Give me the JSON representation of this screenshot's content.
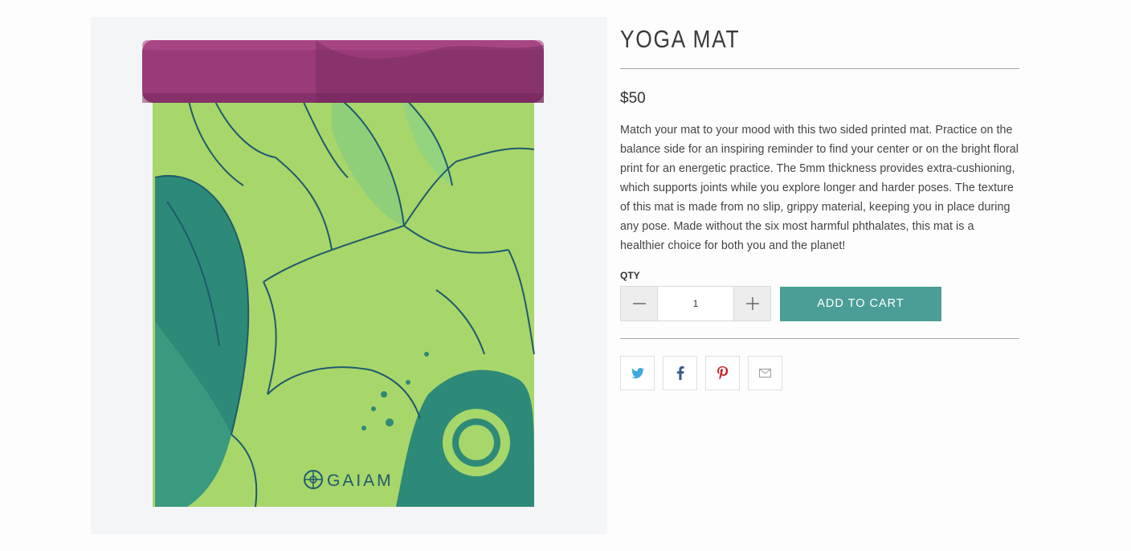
{
  "product": {
    "title": "YOGA MAT",
    "price": "$50",
    "description": "Match your mat to your mood with this two sided printed mat. Practice on the balance side for an inspiring reminder to find your center or on the bright floral print for an energetic practice. The 5mm thickness provides extra-cushioning, which supports joints while you explore longer and harder poses. The texture of this mat is made from no slip, grippy material, keeping you in place during any pose. Made without the six most harmful phthalates, this mat is a healthier choice for both you and the planet!",
    "image": {
      "brand_text": "GAIAM",
      "colors": {
        "roll": "#9b3a78",
        "mat": "#a7d66a",
        "leaf": "#2e8a78",
        "line": "#1f5a6e"
      }
    }
  },
  "purchase": {
    "qty_label": "QTY",
    "qty_value": "1",
    "decrease_icon": "minus-icon",
    "increase_icon": "plus-icon",
    "add_to_cart_label": "ADD TO CART",
    "accent_color": "#4b9e96"
  },
  "share": {
    "buttons": [
      {
        "icon": "twitter-icon",
        "color": "#3fa9dd"
      },
      {
        "icon": "facebook-icon",
        "color": "#3b5a8e"
      },
      {
        "icon": "pinterest-icon",
        "color": "#c8232c"
      },
      {
        "icon": "email-icon",
        "color": "#9a9a9a"
      }
    ]
  }
}
